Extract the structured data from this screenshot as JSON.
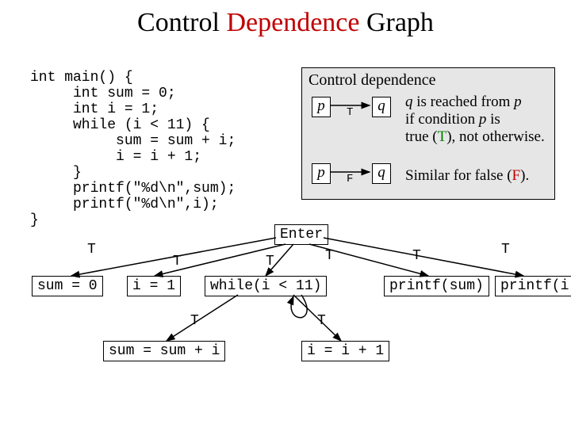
{
  "title": {
    "w1": "Control ",
    "w2": "Dependence",
    "w3": " Graph"
  },
  "code": "int main() {\n     int sum = 0;\n     int i = 1;\n     while (i < 11) {\n          sum = sum + i;\n          i = i + 1;\n     }\n     printf(\"%d\\n\",sum);\n     printf(\"%d\\n\",i);\n}",
  "legend": {
    "title": "Control dependence",
    "p": "p",
    "q": "q",
    "T": "T",
    "F": "F",
    "line1a": " is reached from ",
    "line1b": "if condition ",
    "line1c": " is",
    "line1d": "true (",
    "line1e": "), not otherwise.",
    "line2a": "Similar for false (",
    "line2b": ")."
  },
  "nodes": {
    "enter": "Enter",
    "sum0": "sum = 0",
    "i1": "i = 1",
    "while": "while(i < 11)",
    "psum": "printf(sum)",
    "pi": "printf(i)",
    "sumadd": "sum = sum + i",
    "iadd": "i = i + 1"
  },
  "edgeLabel": "T",
  "chart_data": {
    "type": "diagram",
    "title": "Control Dependence Graph",
    "nodes": [
      "Enter",
      "sum = 0",
      "i = 1",
      "while(i < 11)",
      "printf(sum)",
      "printf(i)",
      "sum = sum + i",
      "i = i + 1"
    ],
    "edges": [
      {
        "from": "Enter",
        "to": "sum = 0",
        "label": "T"
      },
      {
        "from": "Enter",
        "to": "i = 1",
        "label": "T"
      },
      {
        "from": "Enter",
        "to": "while(i < 11)",
        "label": "T"
      },
      {
        "from": "Enter",
        "to": "printf(sum)",
        "label": "T"
      },
      {
        "from": "Enter",
        "to": "printf(i)",
        "label": "T"
      },
      {
        "from": "while(i < 11)",
        "to": "sum = sum + i",
        "label": "T"
      },
      {
        "from": "while(i < 11)",
        "to": "i = i + 1",
        "label": "T"
      },
      {
        "from": "while(i < 11)",
        "to": "while(i < 11)",
        "label": "T"
      }
    ]
  }
}
